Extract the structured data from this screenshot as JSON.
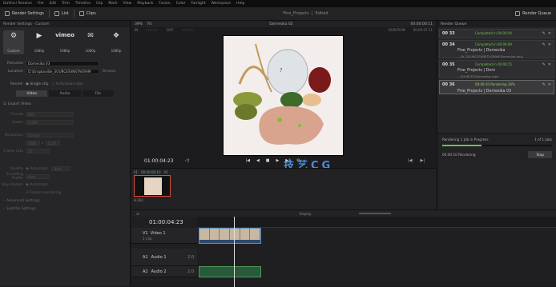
{
  "menu": [
    "DaVinci Resolve",
    "File",
    "Edit",
    "Trim",
    "Timeline",
    "Clip",
    "Mark",
    "View",
    "Playback",
    "Fusion",
    "Color",
    "Fairlight",
    "Workspace",
    "Help"
  ],
  "toolbar": {
    "render_settings": "Render Settings",
    "list": "List",
    "clips": "Clips",
    "project_title": "Fine_Projects",
    "edited": "Edited",
    "render_queue": "Render Queue"
  },
  "left_panel": {
    "title": "Render Settings - Custom",
    "presets": [
      {
        "label": "Custom",
        "sub": "",
        "icon": "⚙"
      },
      {
        "label": "YouTube",
        "sub": "1080p",
        "icon": "▶"
      },
      {
        "label": "vimeo",
        "sub": "1080p",
        "icon": "v"
      },
      {
        "label": "Twitter",
        "sub": "1080p",
        "icon": "✉"
      },
      {
        "label": "Dropbox",
        "sub": "1080p",
        "icon": "❖"
      }
    ],
    "filename_label": "Filename",
    "filename": "Domesika 03",
    "location_label": "Location",
    "location": "D:\\Dropbox\\Be_SOURCES\\INSTAGRAM",
    "browse": "Browse",
    "render_label": "Render",
    "single_clip": "Single clip",
    "individual_clips": "Individual clips",
    "tabs": [
      "Video",
      "Audio",
      "File"
    ],
    "export_video": "Export Video",
    "format_label": "Format",
    "format": "MP4",
    "codec_label": "Codec",
    "codec": "H.264",
    "resolution_label": "Resolution",
    "resolution": "Custom",
    "w": "1080",
    "h": "1176",
    "framerate_label": "Frame rate",
    "framerate": "25",
    "quality_label": "Quality",
    "quality": "Automatic",
    "restrict": "Best",
    "encoding_label": "Encoding Profile",
    "encoding": "Auto",
    "keyframes_label": "Key Frames",
    "keyframes": "Automatic",
    "frame_reordering": "Frame reordering",
    "advanced": "Advanced Settings",
    "subtitle": "Subtitle Settings"
  },
  "viewer": {
    "zoom": "39%",
    "fit": "Fit",
    "title": "Domesika 02",
    "timecode": "00:00:00:11",
    "in_label": "IN",
    "in": "--:--:--:--",
    "out_label": "OUT",
    "out": "--:--:--:--",
    "duration_label": "DURATION",
    "duration": "00:00:07:11",
    "current": "01:00:04:23"
  },
  "clip": {
    "number": "01",
    "timecode": "00:00:00:10",
    "track": "V1",
    "codec": "H.264"
  },
  "watermark": "技艺CG  www.jyxxfb.cn",
  "render_queue": {
    "title": "Render Queue",
    "jobs": [
      {
        "id": "00 33",
        "status": "Completed in 00:00:04",
        "name": "",
        "file": ""
      },
      {
        "id": "00 34",
        "status": "Completed in 00:00:09",
        "name": "Fine_Projects | Domesika",
        "file": "...XX_SOURCES\\INSTAGRAM\\Domesika.mp4"
      },
      {
        "id": "00 35",
        "status": "Completed in 00:00:15",
        "name": "Fine_Projects | Dom",
        "file": "...SOURCES\\Domesika.mp4"
      },
      {
        "id": "00 36",
        "status": "00:00:10 Rendering 36%",
        "name": "Fine_Projects | Domesika 03",
        "file": ""
      }
    ],
    "rendering_label": "Rendering 1 Job in Progress",
    "job_count": "1 of 1 jobs",
    "progress_text": "00:00:10 Rendering",
    "progress": 0.36,
    "stop": "Stop"
  },
  "timeline": {
    "timecode": "01:00:04:23",
    "tracks": [
      {
        "id": "V1",
        "name": "Video 1",
        "clips": "1 Clip"
      },
      {
        "id": "A1",
        "name": "Audio 1",
        "ch": "2.0"
      },
      {
        "id": "A2",
        "name": "Audio 2",
        "ch": "2.0"
      }
    ],
    "display": "Display",
    "zoom_label": "Zoom"
  },
  "colors": {
    "accent": "#6cc24a",
    "watermark": "#4c8dd8",
    "selected": "#e04a3a"
  }
}
